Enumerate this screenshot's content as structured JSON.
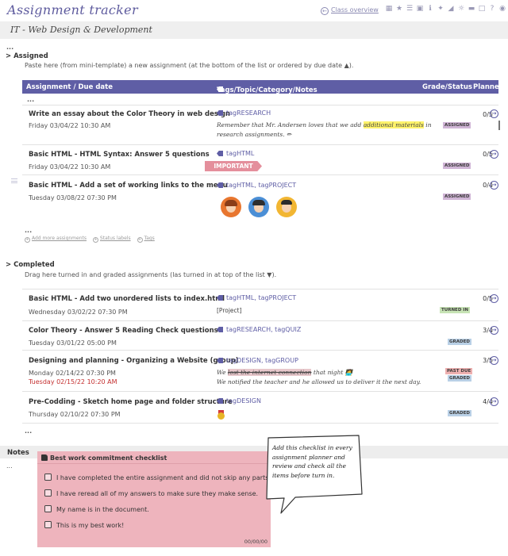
{
  "app": {
    "title": "Assignment tracker",
    "class_overview": "Class overview",
    "subject": "IT - Web Design & Development"
  },
  "toolbar": {
    "icons": [
      "barcode-icon",
      "star-icon",
      "list-icon",
      "calendar-icon",
      "info-icon",
      "pin-icon",
      "chart-icon",
      "sun-icon",
      "folder-icon",
      "document-icon",
      "help-icon",
      "bulb-icon"
    ]
  },
  "assigned": {
    "heading": "> Assigned",
    "hint": "Paste here (from mini-template) a new assignment (at the bottom of the list or ordered by due date ▲).",
    "columns": {
      "assignment": "Assignment / Due date",
      "tags": "Tags/Topic/Category/Notes",
      "grade": "Grade/Status",
      "planner": "Planner"
    },
    "rows": [
      {
        "title": "Write an essay about the Color Theory in web design",
        "due": "Friday 03/04/22 10:30 AM",
        "tags": "tagRESEARCH",
        "note_a": "Remember that Mr. Andersen loves that we add ",
        "note_hl": "additional materials",
        "note_b": " in research assignments. ✏",
        "grade": "0/5",
        "status": "ASSIGNED"
      },
      {
        "title": "Basic HTML - HTML Syntax: Answer 5 questions",
        "due": "Friday 03/04/22 10:30 AM",
        "tags": "tagHTML",
        "priority": "IMPORTANT",
        "grade": "0/5",
        "status": "ASSIGNED"
      },
      {
        "title": "Basic HTML -  Add a set of working links to the menu",
        "due": "Tuesday 03/08/22 07:30 PM",
        "tags": "tagHTML, tagPROJECT",
        "grade": "0/4",
        "status": "ASSIGNED"
      }
    ],
    "footer_links": [
      "Add more assignments",
      "Status labels",
      "Tags"
    ]
  },
  "completed": {
    "heading": "> Completed",
    "hint": "Drag here turned in and graded assignments (las turned in at top of the list ▼).",
    "rows": [
      {
        "title": "Basic HTML -  Add two unordered lists to index.html",
        "due": "Wednesday 03/02/22 07:30 PM",
        "tags": "tagHTML, tagPROJECT",
        "note": "[Project]",
        "grade": "0/5",
        "status": "TURNED IN"
      },
      {
        "title": "Color Theory - Answer 5 Reading Check questions",
        "due": "Tuesday 03/01/22 05:00 PM",
        "tags": "tagRESEARCH, tagQUIZ",
        "grade": "3/4",
        "status": "GRADED"
      },
      {
        "title": "Designing and planning - Organizing a Website (group)",
        "due": "Monday 02/14/22 07:30 PM",
        "turned": "Tuesday 02/15/22 10:20 AM",
        "tags": "tagDESIGN, tagGROUP",
        "note_a": "We ",
        "note_strike": "lost the internet connection",
        "note_b": " that night 🧑‍💻",
        "note_line2": "We notified the teacher and he allowed us to deliver it the next day.",
        "grade": "3/5",
        "status": "PAST DUE",
        "status2": "GRADED"
      },
      {
        "title": "Pre-Codding - Sketch home page and folder structure",
        "due": "Thursday 02/10/22 07:30 PM",
        "tags": "tagDESIGN",
        "grade": "4/4",
        "status": "GRADED"
      }
    ]
  },
  "notes": {
    "label": "Notes",
    "dots": "...",
    "checklist": {
      "title": "Best work commitment checklist",
      "items": [
        "I have completed the entire assignment and did not skip any parts.",
        "I have reread all of my answers to make sure they make sense.",
        "My name is in the document.",
        "This is my best work!"
      ],
      "date": "00/00/00"
    },
    "callout": "Add this checklist in every assignment planner and review and check all the items before turn in."
  },
  "ellipsis": "..."
}
